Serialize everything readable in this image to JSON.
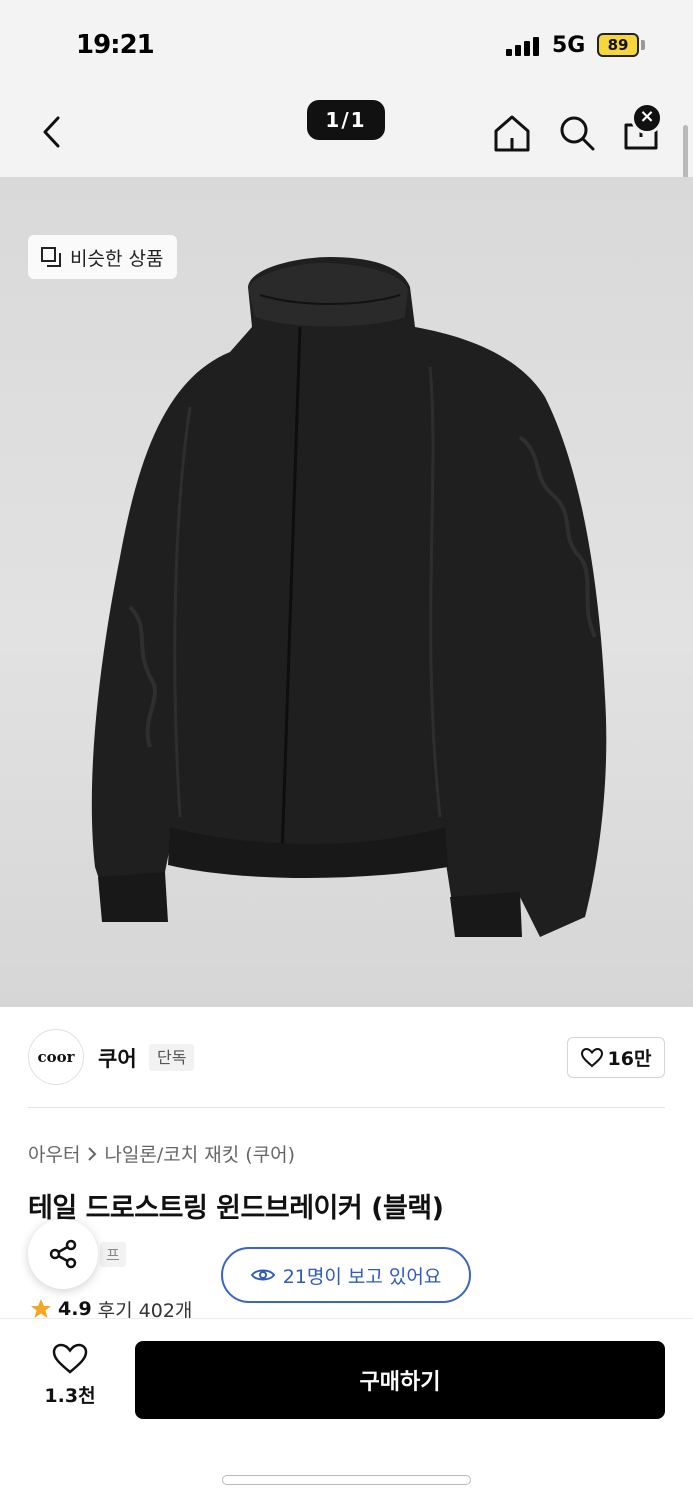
{
  "status_bar": {
    "time": "19:21",
    "network": "5G",
    "battery": "89"
  },
  "nav": {
    "image_counter": "1/1"
  },
  "hero": {
    "similar_products_label": "비슷한 상품"
  },
  "brand": {
    "logo_text": "coor",
    "name": "쿠어",
    "badge": "단독",
    "like_count": "16만"
  },
  "product": {
    "breadcrumb": [
      "아우터",
      "나일론/코치 재킷 (쿠어)"
    ],
    "title": "테일 드로스트링 윈드브레이커 (블랙)",
    "tag_partial": "프",
    "viewers_text": "21명이 보고 있어요",
    "rating": "4.9",
    "reviews_text": "후기 402개"
  },
  "bottom_bar": {
    "wish_count": "1.3천",
    "buy_label": "구매하기"
  },
  "colors": {
    "accent_blue": "#2f5bbf",
    "star": "#f5a623",
    "buy_button": "#000000"
  },
  "icons": [
    "back-icon",
    "home-icon",
    "search-icon",
    "share-box-icon",
    "close-icon",
    "similar-icon",
    "heart-icon",
    "share-icon",
    "eye-icon",
    "star-icon"
  ]
}
